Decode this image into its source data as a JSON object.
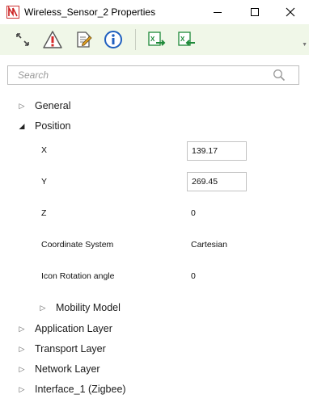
{
  "window": {
    "title": "Wireless_Sensor_2 Properties",
    "controls": {
      "minimize": "minimize-icon",
      "maximize": "maximize-icon",
      "close": "close-icon"
    }
  },
  "toolbar": {
    "buttons": [
      {
        "icon": "expand-collapse-icon"
      },
      {
        "icon": "warning-icon"
      },
      {
        "icon": "edit-document-icon"
      },
      {
        "icon": "info-icon"
      },
      {
        "icon": "excel-export-icon"
      },
      {
        "icon": "excel-import-icon"
      }
    ]
  },
  "search": {
    "placeholder": "Search",
    "value": ""
  },
  "tree": {
    "general": "General",
    "position": "Position",
    "mobility_model": "Mobility Model",
    "application_layer": "Application Layer",
    "transport_layer": "Transport Layer",
    "network_layer": "Network Layer",
    "interface_1": "Interface_1 (Zigbee)"
  },
  "position_props": {
    "x_label": "X",
    "x_value": "139.17",
    "y_label": "Y",
    "y_value": "269.45",
    "z_label": "Z",
    "z_value": "0",
    "coord_label": "Coordinate System",
    "coord_value": "Cartesian",
    "rotation_label": "Icon Rotation angle",
    "rotation_value": "0"
  },
  "colors": {
    "toolbar_bg": "#f0f7e8",
    "accent_red": "#d42a2a",
    "accent_blue": "#1f5fbf",
    "excel_green": "#1f8a3a"
  }
}
